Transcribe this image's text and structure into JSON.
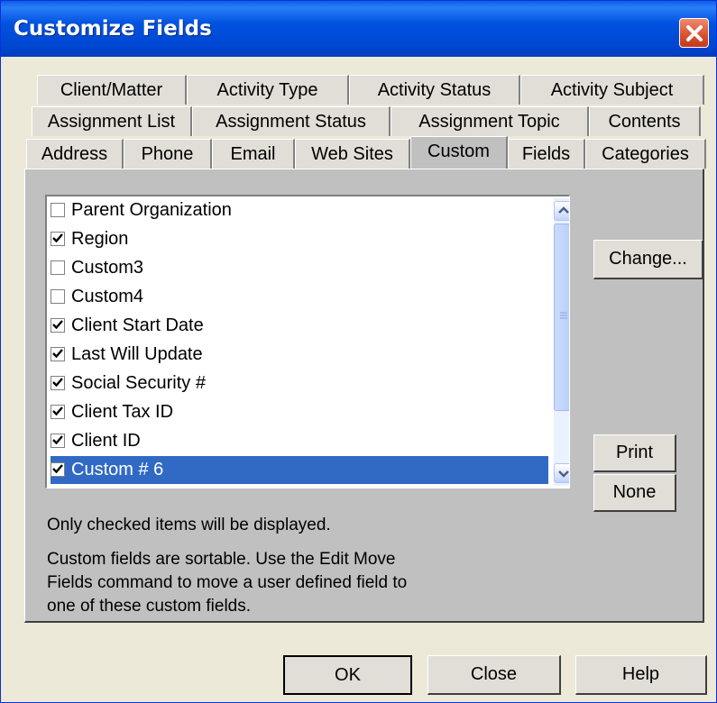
{
  "window": {
    "title": "Customize Fields"
  },
  "tabs": {
    "row1": [
      "Client/Matter",
      "Activity Type",
      "Activity Status",
      "Activity Subject"
    ],
    "row2": [
      "Assignment List",
      "Assignment Status",
      "Assignment Topic",
      "Contents"
    ],
    "row3": [
      "Address",
      "Phone",
      "Email",
      "Web Sites",
      "Custom",
      "Fields",
      "Categories"
    ],
    "active": "Custom"
  },
  "fields_list": [
    {
      "label": "Parent Organization",
      "checked": false
    },
    {
      "label": "Region",
      "checked": true
    },
    {
      "label": "Custom3",
      "checked": false
    },
    {
      "label": "Custom4",
      "checked": false
    },
    {
      "label": "Client Start Date",
      "checked": true
    },
    {
      "label": "Last Will Update",
      "checked": true
    },
    {
      "label": "Social Security #",
      "checked": true
    },
    {
      "label": "Client Tax ID",
      "checked": true
    },
    {
      "label": "Client ID",
      "checked": true
    },
    {
      "label": "Custom # 6",
      "checked": true,
      "selected": true
    }
  ],
  "side_buttons": {
    "change": "Change...",
    "print": "Print",
    "none": "None"
  },
  "notes": {
    "line1": "Only checked items will be displayed.",
    "line2": "Custom fields are sortable.  Use the Edit Move",
    "line3": "Fields command to move a user defined field to",
    "line4": "one of these custom fields."
  },
  "footer_buttons": {
    "ok": "OK",
    "close": "Close",
    "help": "Help"
  },
  "colors": {
    "titlebar": "#0054e3",
    "selection": "#316ac5",
    "panel": "#c0c0c0",
    "dialog": "#ece9d8"
  }
}
